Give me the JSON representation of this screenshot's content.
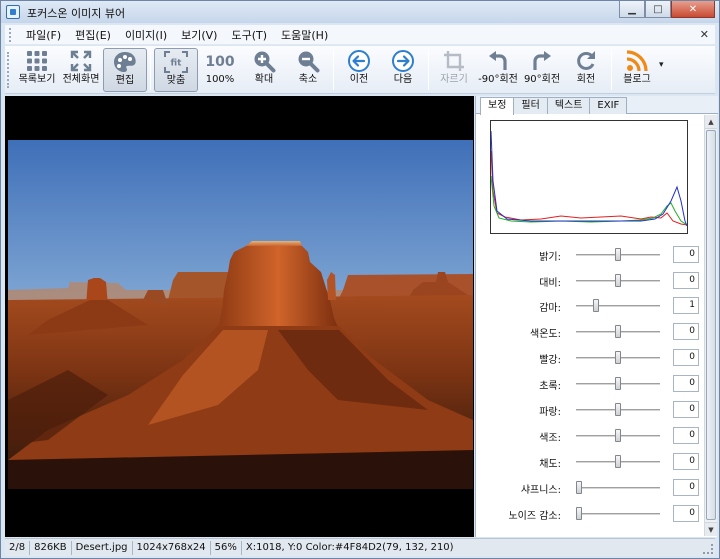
{
  "window": {
    "title": "포커스온 이미지 뷰어"
  },
  "menubar": {
    "items": [
      "파일(F)",
      "편집(E)",
      "이미지(I)",
      "보기(V)",
      "도구(T)",
      "도움말(H)"
    ],
    "close_glyph": "✕"
  },
  "toolbar": {
    "thumbnails": "목록보기",
    "fullscreen": "전체화면",
    "edit": "편집",
    "fit": "맞춤",
    "actual_size": "100%",
    "actual_size_icon_text": "100",
    "fit_icon_text": "fit",
    "zoom_in": "확대",
    "zoom_out": "축소",
    "previous": "이전",
    "next": "다음",
    "crop": "자르기",
    "rotate_ccw": "-90°회전",
    "rotate_cw": "90°회전",
    "rotate": "회전",
    "blog": "블로그",
    "dropdown_glyph": "▾"
  },
  "panel": {
    "tabs": [
      "보정",
      "필터",
      "텍스트",
      "EXIF"
    ],
    "active_tab": "보정",
    "adjustments": [
      {
        "label": "밝기:",
        "value": "0",
        "level": 0.5
      },
      {
        "label": "대비:",
        "value": "0",
        "level": 0.5
      },
      {
        "label": "감마:",
        "value": "1",
        "level": 0.22
      },
      {
        "label": "색온도:",
        "value": "0",
        "level": 0.5
      },
      {
        "label": "빨강:",
        "value": "0",
        "level": 0.5
      },
      {
        "label": "초록:",
        "value": "0",
        "level": 0.5
      },
      {
        "label": "파랑:",
        "value": "0",
        "level": 0.5
      },
      {
        "label": "색조:",
        "value": "0",
        "level": 0.5
      },
      {
        "label": "채도:",
        "value": "0",
        "level": 0.5
      },
      {
        "label": "샤프니스:",
        "value": "0",
        "level": 0.0
      },
      {
        "label": "노이즈 감소:",
        "value": "0",
        "level": 0.0
      }
    ]
  },
  "statusbar": {
    "index": "2/8",
    "filesize": "826KB",
    "filename": "Desert.jpg",
    "dimensions": "1024x768x24",
    "zoom": "56%",
    "pixel_info": "X:1018, Y:0 Color:#4F84D2(79, 132, 210)"
  },
  "colors": {
    "accent": "#2f7fd0",
    "histogram_red": "#e02020",
    "histogram_green": "#20b020",
    "histogram_blue": "#2030d0"
  }
}
